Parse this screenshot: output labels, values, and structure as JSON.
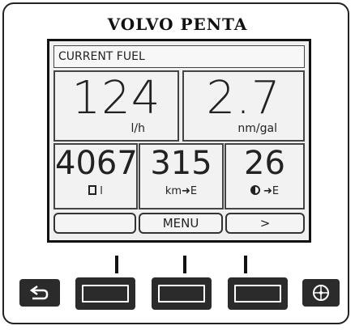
{
  "brand": "VOLVO PENTA",
  "screen": {
    "header": "CURRENT FUEL",
    "primary": [
      {
        "value": "124",
        "unit": "l/h"
      },
      {
        "value": "2.7",
        "unit": "nm/gal"
      }
    ],
    "secondary": [
      {
        "value": "4067",
        "unit": "l",
        "icon": "fuel-pump-icon"
      },
      {
        "value": "315",
        "unit": "km➜E",
        "icon": "arrow-icon"
      },
      {
        "value": "26",
        "unit": "➜E",
        "icon": "clock-arrow-icon"
      }
    ],
    "softkeys": [
      "",
      "MENU",
      ">"
    ]
  },
  "hardware": {
    "left_icon": "return-icon",
    "right_icon": "helm-icon"
  }
}
